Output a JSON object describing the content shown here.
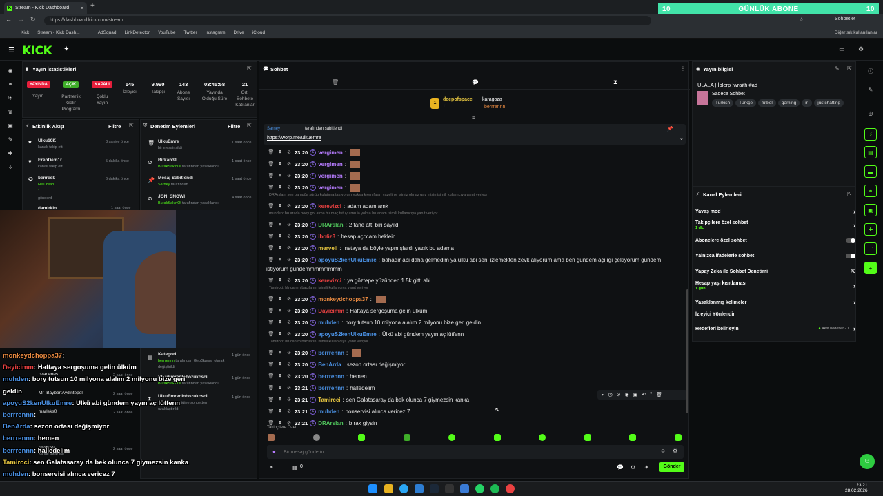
{
  "browser": {
    "tab_title": "Stream - Kick Dashboard",
    "url": "https://dashboard.kick.com/stream",
    "bookmarks": [
      "Kick",
      "Stream - Kick Dash...",
      "AdSquad",
      "LinkDetector",
      "YouTube",
      "Twitter",
      "Instagram",
      "Drive",
      "iCloud"
    ],
    "other_bookmarks": "Diğer sık kullanılanlar",
    "chat_button": "Sohbet et"
  },
  "banner": {
    "left": "10",
    "title": "GÜNLÜK ABONE",
    "right": "10"
  },
  "stats": {
    "title": "Yayın İstatistikleri",
    "badges": [
      {
        "label": "YAYINDA",
        "caption": "Yayın",
        "color": "#e61f3c"
      },
      {
        "label": "AÇIK",
        "caption": "Partnerlik Gelir Programı",
        "color": "#3fae29"
      },
      {
        "label": "KAPALI",
        "caption": "Çoklu Yayın",
        "color": "#e61f3c"
      }
    ],
    "items": [
      {
        "value": "145",
        "caption": "İzleyici"
      },
      {
        "value": "9.990",
        "caption": "Takipçi"
      },
      {
        "value": "143",
        "caption": "Abone Sayısı"
      },
      {
        "value": "03:45:58",
        "caption": "Yayında Olduğu Süre"
      },
      {
        "value": "21",
        "caption": "Ort. Sohbete Katılanlar"
      }
    ]
  },
  "activity": {
    "title": "Etkinlik Akışı",
    "filter": "Filtre",
    "items": [
      {
        "user": "Ulku10K",
        "desc": "kanalı takip etti",
        "time": "3 saniye önce"
      },
      {
        "user": "ErenDem1r",
        "desc": "kanalı takip etti",
        "time": "5 dakika önce"
      },
      {
        "user": "benresk",
        "desc": "Hell Yeah",
        "extra": "1",
        "extra2": "gönderdi",
        "time": "6 dakika önce"
      },
      {
        "user": "damirkin",
        "desc": "",
        "time": "1 saat önce"
      }
    ]
  },
  "moderation": {
    "title": "Denetim Eylemleri",
    "filter": "Filtre",
    "items": [
      {
        "user": "UlkuEmre",
        "desc": "bir mesajı sildi",
        "time": "1 saat önce"
      },
      {
        "user": "Birkan31",
        "by": "BurakSakinOl",
        "desc": "tarafından yasaklandı",
        "time": "1 saat önce"
      },
      {
        "user": "Mesaj Sabitlendi",
        "by": "Sarney",
        "desc": "tarafından",
        "time": "1 saat önce"
      },
      {
        "user": "JON_SNOWI",
        "by": "BurakSakinOl",
        "desc": "tarafından yasaklandı",
        "time": "4 saat önce"
      },
      {
        "user": "Kategori",
        "by": "berrrennn",
        "desc": "tarafından GeoGuessr olarak değiştirildi",
        "time": "1 gün önce"
      },
      {
        "user": "UlkuEmrenInbozukcsci",
        "by": "BurakSakinOl",
        "desc": "tarafından yasaklandı",
        "time": "1 gün önce"
      },
      {
        "user": "UlkuEmrenInbozukcsci",
        "desc": "5 dakika süreliğine sohbetten uzaklaştırıldı",
        "time": "1 gün önce"
      }
    ]
  },
  "chat": {
    "title": "Sohbet",
    "top_gifters": [
      {
        "name": "deepofspace",
        "count": "11"
      },
      {
        "name": "karagoza",
        "count": "5"
      },
      {
        "name": "berrrennn",
        "count": "5"
      }
    ],
    "pinned": {
      "by": "Sarney",
      "label": "tarafından sabitlendi",
      "link": "https://worp.me/ulkuemre"
    },
    "messages": [
      {
        "time": "23:20",
        "user": "vergimen",
        "color": "#b67cff",
        "text": ""
      },
      {
        "time": "23:20",
        "user": "vergimen",
        "color": "#b67cff",
        "text": ""
      },
      {
        "time": "23:20",
        "user": "vergimen",
        "color": "#b67cff",
        "text": ""
      },
      {
        "time": "23:20",
        "user": "vergimen",
        "color": "#b67cff",
        "text": ""
      },
      {
        "reply": "DRArslan: sen pamuğa sürüp kulağına takıyorum yoksa krem falan vazelinle isimiz olmaz gay misin isimili kullanıcıya yanıt veriyor",
        "time": "23:20",
        "user": "kerevizci",
        "color": "#e94141",
        "text": "adam adam amk"
      },
      {
        "reply": "muhden: bu arada boey gol atma bu maç tutuyu mu ia yoksa bu adam isimili kullanıcıya yanıt veriyor",
        "time": "23:20",
        "user": "DRArslan",
        "color": "#4fc45b",
        "text": "2 tane attı biri sayıldı"
      },
      {
        "time": "23:20",
        "user": "ibo6z3",
        "color": "#e94141",
        "text": "hesap açccam beklein"
      },
      {
        "time": "23:20",
        "user": "merveii",
        "color": "#e9c841",
        "text": "İnstaya da böyle yapmışlardı yazık bu adama"
      },
      {
        "time": "23:20",
        "user": "apoyuS2kenUlkuEmre",
        "color": "#4a90e2",
        "text": "bahadır abi daha gelmedim ya ülkü abi seni izlemekten zevk alıyorum ama ben gündem açılığı çekiyorum gündem",
        "text2": "istiyorum gündemmmmmmmm"
      },
      {
        "time": "23:20",
        "user": "kerevizci",
        "color": "#e94141",
        "text": "ya göztepe yüzünden 1.5k gitti abi"
      },
      {
        "reply": "Tamircci: hb canım bacılarını isimili kullanıcıya yanıt veriyor",
        "time": "23:20",
        "user": "monkeydchoppa37",
        "color": "#e98a41",
        "text": ""
      },
      {
        "time": "23:20",
        "user": "Dayicimm",
        "color": "#e94141",
        "text": "Haftaya sergoşuma gelin ülküm"
      },
      {
        "time": "23:20",
        "user": "muhden",
        "color": "#4a90e2",
        "text": "bory tutsun 10 milyona alalım 2 milyonu bize geri geldin"
      },
      {
        "time": "23:20",
        "user": "apoyuS2kenUlkuEmre",
        "color": "#4a90e2",
        "text": "Ülkü abi gündem yayın aç lütfenn"
      },
      {
        "reply": "Tamircci: hb canım bacılarını isimili kullanıcıya yanıt veriyor",
        "time": "23:20",
        "user": "berrrennn",
        "color": "#4a90e2",
        "text": ""
      },
      {
        "time": "23:20",
        "user": "BenArda",
        "color": "#4a90e2",
        "text": "sezon ortası değişmiyor"
      },
      {
        "time": "23:20",
        "user": "berrrennn",
        "color": "#4a90e2",
        "text": "hemen"
      },
      {
        "time": "23:21",
        "user": "berrrennn",
        "color": "#4a90e2",
        "text": "halledelim"
      },
      {
        "time": "23:21",
        "user": "Tamircci",
        "color": "#e9c841",
        "text": "sen Galatasaray da bek olunca 7 giymezsin kanka"
      },
      {
        "time": "23:21",
        "user": "muhden",
        "color": "#4a90e2",
        "text": "bonservisi alınca vericez 7"
      },
      {
        "time": "23:21",
        "user": "DRArslan",
        "color": "#4fc45b",
        "text": "bırak giysin"
      }
    ],
    "followers_only": "Takipçilere Özel",
    "placeholder": "Bir mesaj gönderin",
    "send": "Gönder",
    "bottom_count": "0"
  },
  "stream_info": {
    "title": "Yayın bilgisi",
    "stream_title": "ULALA | İblerp !wraith #ad",
    "category": "Sadece Sohbet",
    "tags": [
      "Turkish",
      "Türkçe",
      "futbol",
      "gaming",
      "irl",
      "justchatting"
    ]
  },
  "channel_actions": {
    "title": "Kanal Eylemleri",
    "items": [
      {
        "label": "Yavaş mod",
        "control": "arrow"
      },
      {
        "label": "Takipçilere özel sohbet",
        "sub": "1 dk.",
        "control": "arrow"
      },
      {
        "label": "Abonelere özel sohbet",
        "control": "toggle"
      },
      {
        "label": "Yalnızca ifadelerle sohbet",
        "control": "toggle"
      },
      {
        "label": "Yapay Zeka ile Sohbet Denetimi",
        "control": "link"
      },
      {
        "label": "Hesap yaşı kısıtlaması",
        "sub": "1 gün",
        "control": "arrow"
      },
      {
        "label": "Yasaklanmış kelimeler",
        "control": "arrow"
      },
      {
        "label": "İzleyici Yönlendir",
        "control": "none"
      },
      {
        "label": "Hedefleri belirleyin",
        "status": "Aktif hedefler - 1",
        "control": "arrow"
      }
    ]
  },
  "overlay": {
    "lines": [
      {
        "user": "monkeydchoppa37",
        "color": "#e98a41",
        "text": ":"
      },
      {
        "user": "Dayicimm",
        "color": "#e94141",
        "text": ": Haftaya sergoşuma gelin ülküm"
      },
      {
        "user": "muhden",
        "color": "#4a90e2",
        "text": ": bory tutsun 10 milyona alalım 2 milyonu bize geri"
      },
      {
        "user": "",
        "color": "#fff",
        "text": "geldin"
      },
      {
        "user": "apoyuS2kenUlkuEmre",
        "color": "#4a90e2",
        "text": ": Ülkü abi gündem yayın aç lütfenn"
      },
      {
        "user": "berrrennn",
        "color": "#4a90e2",
        "text": ":"
      },
      {
        "user": "BenArda",
        "color": "#4a90e2",
        "text": ": sezon ortası değişmiyor"
      },
      {
        "user": "berrrennn",
        "color": "#4a90e2",
        "text": ": hemen"
      },
      {
        "user": "berrrennn",
        "color": "#4a90e2",
        "text": ": halledelim"
      },
      {
        "user": "Tamircci",
        "color": "#e9c841",
        "text": ": sen Galatasaray da bek olunca 7 giymezsin kanka"
      },
      {
        "user": "muhden",
        "color": "#4a90e2",
        "text": ": bonservisi alınca vericez 7"
      },
      {
        "user": "DRArslan",
        "color": "#4fc45b",
        "text": ": bırak giysin"
      }
    ],
    "under_feed": [
      {
        "user": "ozarienes",
        "time": "2 saat önce"
      },
      {
        "user": "Mr_BaybartAydintepeli",
        "time": "2 saat önce"
      },
      {
        "user": "marleks0",
        "time": "2 saat önce"
      },
      {
        "user": "saatkafa",
        "time": "2 saat önce"
      }
    ],
    "sub_text": "kanalı takip etti"
  },
  "taskbar": {
    "time": "23:21",
    "date": "28.02.2026"
  }
}
